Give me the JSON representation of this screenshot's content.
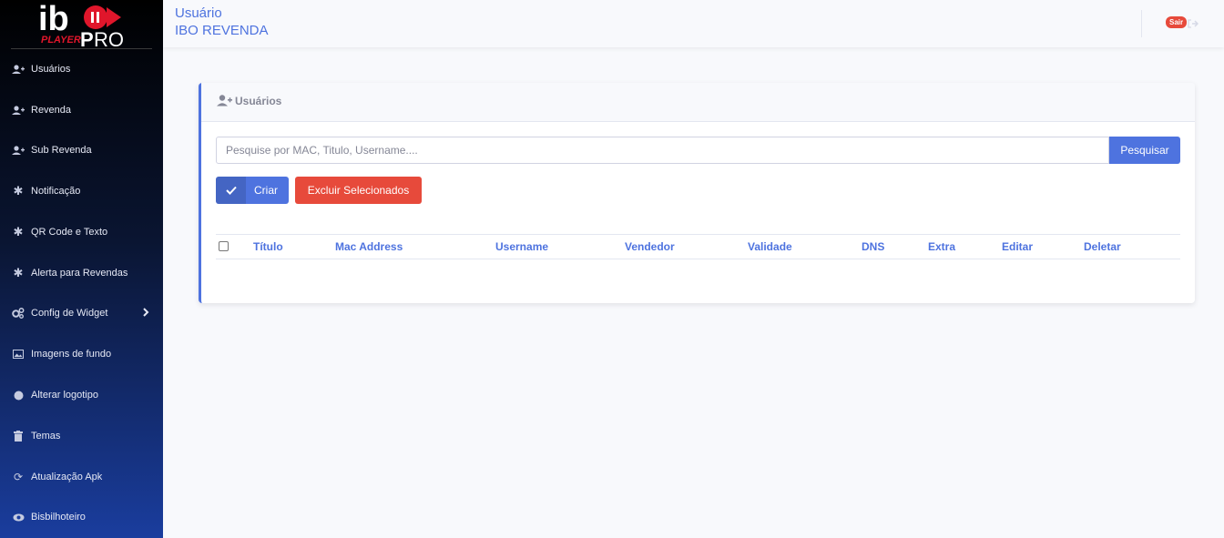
{
  "brand": {
    "logo_text_main": "ibo",
    "logo_text_sub": "PLAYER",
    "logo_text_pro": "RO"
  },
  "sidebar": {
    "items": [
      {
        "label": "Usuários",
        "icon": "user-plus-icon"
      },
      {
        "label": "Revenda",
        "icon": "user-plus-icon"
      },
      {
        "label": "Sub Revenda",
        "icon": "user-plus-icon"
      },
      {
        "label": "Notificação",
        "icon": "asterisk-icon"
      },
      {
        "label": "QR Code e Texto",
        "icon": "asterisk-icon"
      },
      {
        "label": "Alerta para Revendas",
        "icon": "asterisk-icon"
      },
      {
        "label": "Config de Widget",
        "icon": "cogs-icon"
      },
      {
        "label": "Imagens de fundo",
        "icon": "image-icon"
      },
      {
        "label": "Alterar logotipo",
        "icon": "circle-icon"
      },
      {
        "label": "Temas",
        "icon": "trash-icon"
      },
      {
        "label": "Atualização Apk",
        "icon": "sync-icon"
      },
      {
        "label": "Bisbilhoteiro",
        "icon": "eye-icon"
      }
    ]
  },
  "topbar": {
    "title": "Usuário",
    "subtitle": "IBO REVENDA",
    "logout_label": "Sair"
  },
  "card": {
    "title": "Usuários",
    "search_placeholder": "Pesquise por MAC, Titulo, Username....",
    "search_button": "Pesquisar",
    "create_button": "Criar",
    "delete_selected_button": "Excluir Selecionados",
    "columns": [
      "Título",
      "Mac Address",
      "Username",
      "Vendedor",
      "Validade",
      "DNS",
      "Extra",
      "Editar",
      "Deletar"
    ]
  },
  "colors": {
    "primary": "#4e73df",
    "danger": "#e74a3b",
    "sidebar_top": "#000000",
    "sidebar_bottom": "#1a3d9e"
  }
}
